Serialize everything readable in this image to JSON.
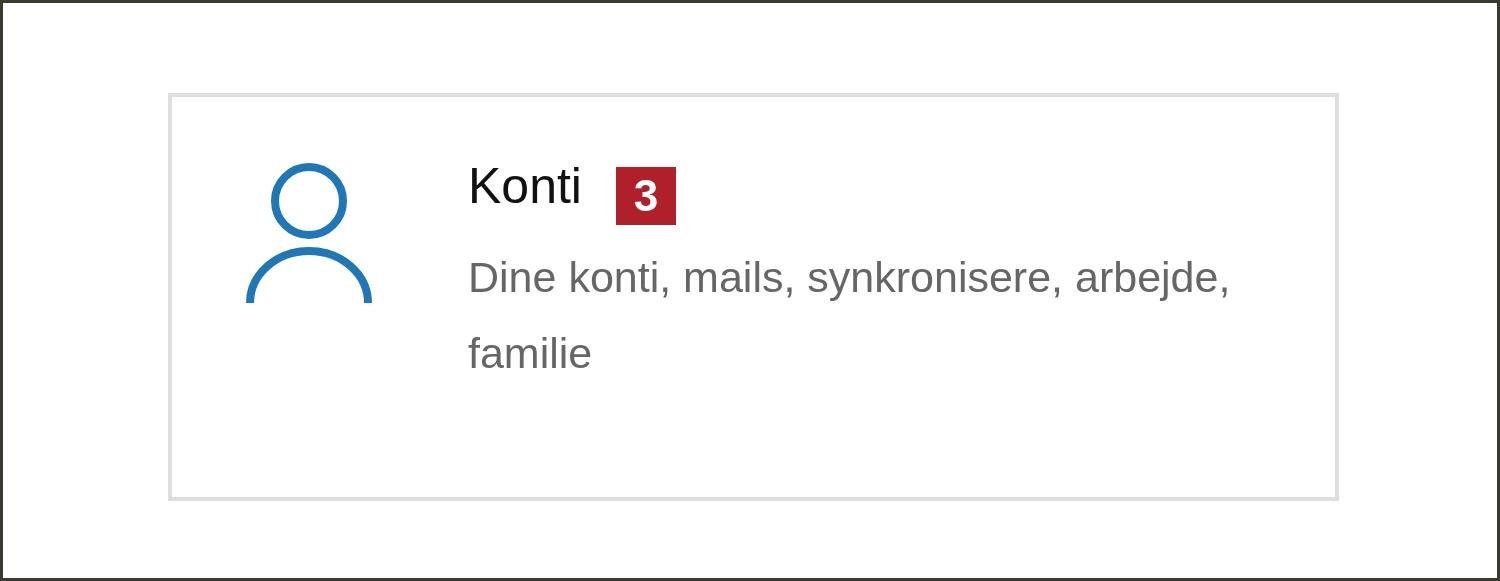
{
  "tile": {
    "title": "Konti",
    "badge": "3",
    "description": "Dine konti, mails, synkronisere, arbejde, familie"
  }
}
